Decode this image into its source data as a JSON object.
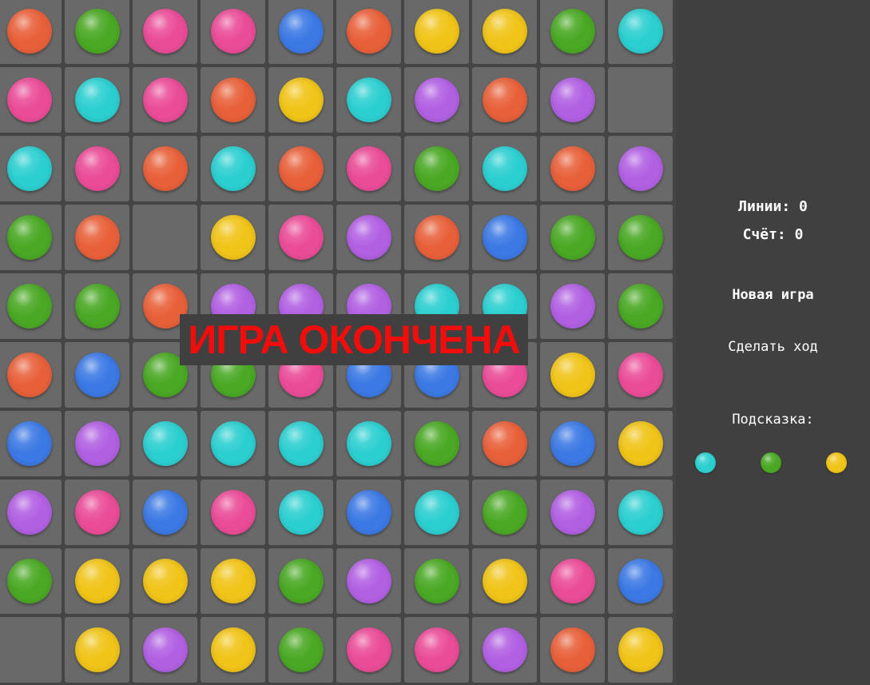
{
  "colors": {
    "O": "#e8603a",
    "G": "#4aa824",
    "P": "#ea4c97",
    "B": "#3c79e4",
    "Y": "#f0c418",
    "C": "#2ccfd0",
    "V": "#b160e2"
  },
  "board": [
    [
      "O",
      "G",
      "P",
      "P",
      "B",
      "O",
      "Y",
      "Y",
      "G",
      "C"
    ],
    [
      "P",
      "C",
      "P",
      "O",
      "Y",
      "C",
      "V",
      "O",
      "V",
      ""
    ],
    [
      "C",
      "P",
      "O",
      "C",
      "O",
      "P",
      "G",
      "C",
      "O",
      "V"
    ],
    [
      "G",
      "O",
      "",
      "Y",
      "P",
      "V",
      "O",
      "B",
      "G",
      "G"
    ],
    [
      "G",
      "G",
      "O",
      "V",
      "V",
      "V",
      "C",
      "C",
      "V",
      "G"
    ],
    [
      "O",
      "B",
      "G",
      "G",
      "P",
      "B",
      "B",
      "P",
      "Y",
      "P"
    ],
    [
      "B",
      "V",
      "C",
      "C",
      "C",
      "C",
      "G",
      "O",
      "B",
      "Y"
    ],
    [
      "V",
      "P",
      "B",
      "P",
      "C",
      "B",
      "C",
      "G",
      "V",
      "C"
    ],
    [
      "G",
      "Y",
      "Y",
      "Y",
      "G",
      "V",
      "G",
      "Y",
      "P",
      "B"
    ],
    [
      "",
      "Y",
      "V",
      "Y",
      "G",
      "P",
      "P",
      "V",
      "O",
      "Y"
    ]
  ],
  "overlay": {
    "text": "ИГРА ОКОНЧЕНА"
  },
  "panel": {
    "lines_label": "Линии:",
    "lines_value": "0",
    "score_label": "Счёт:",
    "score_value": "0",
    "new_game": "Новая игра",
    "make_move": "Сделать ход",
    "hint_label": "Подсказка:",
    "hint_balls": [
      "C",
      "G",
      "Y"
    ]
  }
}
